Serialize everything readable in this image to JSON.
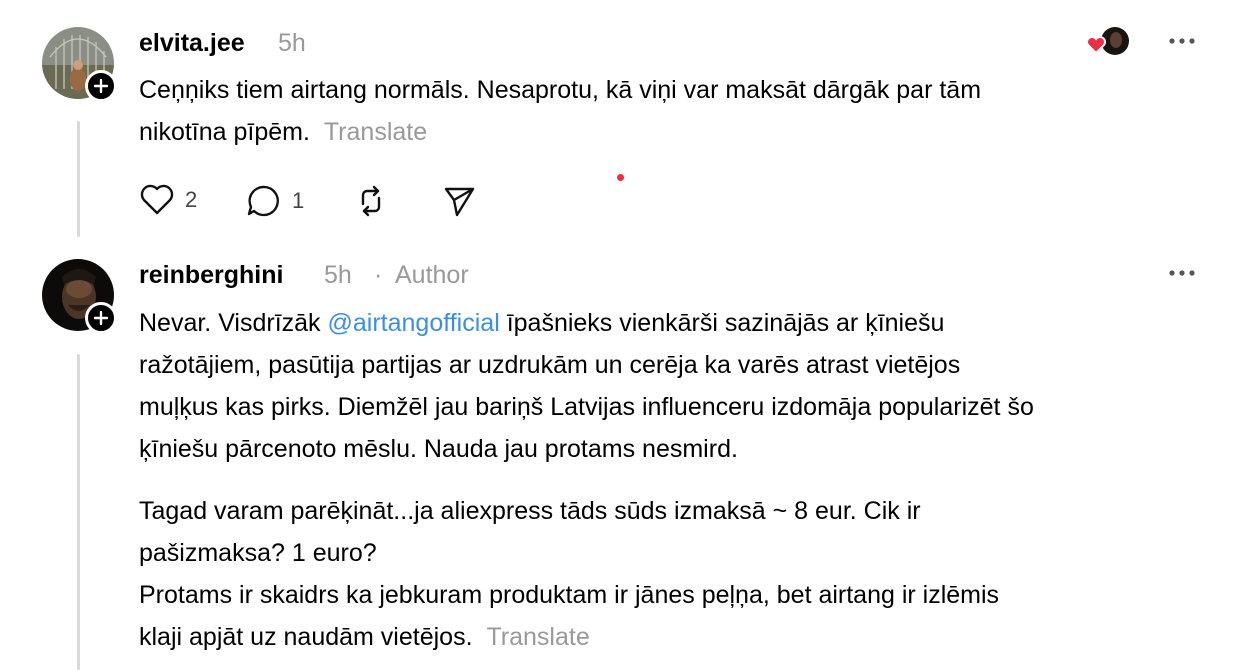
{
  "comments": [
    {
      "username": "elvita.jee",
      "time": "5h",
      "lines": [
        "Ceņņiks tiem airtang normāls. Nesaprotu, kā viņi var maksāt dārgāk par tām",
        "nikotīna pīpēm."
      ],
      "translate": "Translate",
      "likes": "2",
      "replies": "1",
      "icons": {
        "like": "heart-icon",
        "reply": "comment-icon",
        "repost": "repost-icon",
        "share": "send-icon",
        "more": "more-icon",
        "follow": "plus-icon"
      }
    },
    {
      "username": "reinberghini",
      "time": "5h",
      "separator": "·",
      "badge": "Author",
      "p1_before": "Nevar. Visdrīzāk ",
      "p1_mention": "@airtangofficial",
      "p1_after": " īpašnieks vienkārši sazinājās ar ķīniešu",
      "p1_lines": [
        "ražotājiem, pasūtija partijas ar uzdrukām un cerēja ka varēs atrast vietējos",
        "muļķus kas pirks. Diemžēl jau bariņš Latvijas influenceru izdomāja popularizēt šo",
        "ķīniešu pārcenoto mēslu. Nauda jau protams nesmird."
      ],
      "p2_lines": [
        "Tagad varam parēķināt...ja aliexpress tāds sūds izmaksā ~ 8 eur. Cik ir",
        "pašizmaksa? 1 euro?",
        "Protams ir skaidrs ka jebkuram produktam ir jānes peļņa, bet airtang ir izlēmis"
      ],
      "p2_last": "klaji apjāt uz naudām vietējos.",
      "translate": "Translate"
    }
  ],
  "colors": {
    "text": "#000000",
    "muted": "#999999",
    "mention": "#3b8ee8",
    "heart": "#ef2b46",
    "thread_line": "#d9d9d9"
  }
}
